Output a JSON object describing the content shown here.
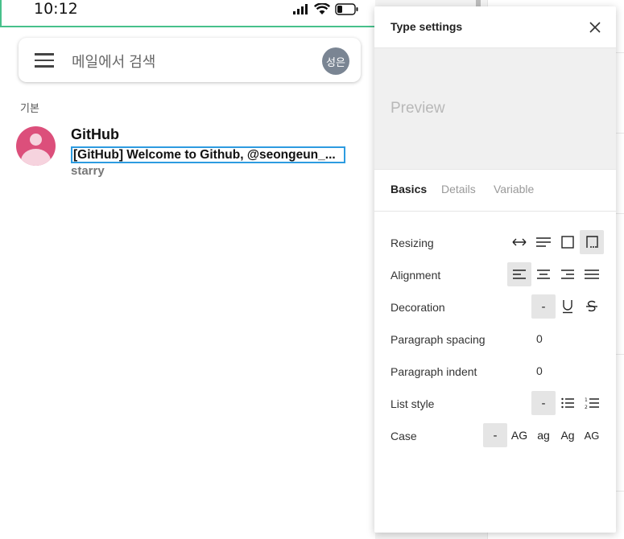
{
  "status": {
    "time": "10:12"
  },
  "search": {
    "placeholder": "메일에서 검색",
    "avatar_initials": "성은"
  },
  "inbox": {
    "section": "기본",
    "mail": {
      "sender": "GitHub",
      "subject": "[GitHub] Welcome to Github, @seongeun_...",
      "snippet": "starry"
    }
  },
  "panel": {
    "title": "Type settings",
    "preview": "Preview",
    "tabs": [
      {
        "label": "Basics",
        "active": true
      },
      {
        "label": "Details",
        "active": false
      },
      {
        "label": "Variable",
        "active": false
      }
    ],
    "rows": {
      "resizing": "Resizing",
      "alignment": "Alignment",
      "decoration": "Decoration",
      "paragraph_spacing": "Paragraph spacing",
      "paragraph_indent": "Paragraph indent",
      "list_style": "List style",
      "case": "Case"
    },
    "values": {
      "paragraph_spacing": "0",
      "paragraph_indent": "0"
    },
    "decoration_none": "-",
    "list_none": "-",
    "case_options": [
      "-",
      "AG",
      "ag",
      "Ag",
      "AG"
    ]
  },
  "colors": {
    "accent_green": "#47c08b",
    "focus_blue": "#2d9be0",
    "avatar_pink": "#dc4f7b"
  }
}
